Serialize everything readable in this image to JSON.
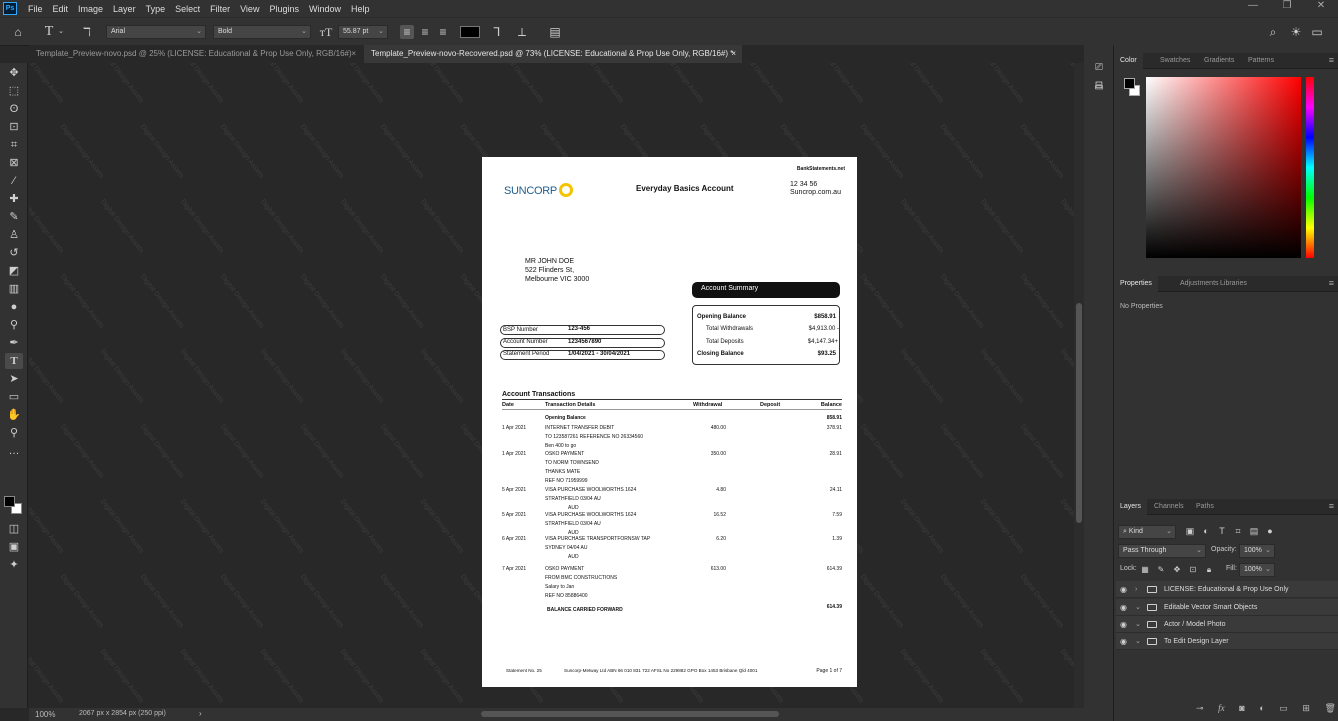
{
  "app": {
    "logo": "Ps"
  },
  "menu": [
    "File",
    "Edit",
    "Image",
    "Layer",
    "Type",
    "Select",
    "Filter",
    "View",
    "Plugins",
    "Window",
    "Help"
  ],
  "options": {
    "font_family": "Arial",
    "font_style": "Bold",
    "font_size": "55.87 pt",
    "text_color": "#000000"
  },
  "tabs": [
    {
      "label": "Template_Preview-novo.psd @ 25% (LICENSE: Educational & Prop Use Only, RGB/16#)",
      "close": "×"
    },
    {
      "label": "Template_Preview-novo-Recovered.psd @ 73% (LICENSE: Educational & Prop Use Only, RGB/16#) *",
      "close": "×"
    }
  ],
  "watermark_text": "Digital Design Assets",
  "statement": {
    "site": "BankStatements.net",
    "brand": "SUNCORP",
    "account_title": "Everyday Basics Account",
    "phone": "12 34 56",
    "web": "Suncrop.com.au",
    "addr1": "MR JOHN DOE",
    "addr2": "522 Flinders St,",
    "addr3": "Melbourne VIC 3000",
    "summary_title": "Account Summary",
    "bsb_label": "BSP Number",
    "bsb": "123-456",
    "acct_label": "Account Number",
    "acct": "1234567890",
    "period_label": "Statement Period",
    "period": "1/04/2021 - 30/04/2021",
    "opening_label": "Opening Balance",
    "opening": "$858.91",
    "withdrawals_label": "Total Withdrawals",
    "withdrawals": "$4,913.00 -",
    "deposits_label": "Total Deposits",
    "deposits": "$4,147.34+",
    "closing_label": "Closing Balance",
    "closing": "$93.25",
    "tx_title": "Account Transactions",
    "tx_cols": {
      "date": "Date",
      "details": "Transaction Details",
      "withdrawal": "Withdrawal",
      "deposit": "Deposit",
      "balance": "Balance"
    },
    "tx_opening_label": "Opening Balance",
    "tx_opening": "858.91",
    "tx": [
      {
        "date": "1 Apr 2021",
        "lines": [
          "INTERNET TRANSFER DEBIT",
          "TO 123587261 REFERENCE NO 26334560",
          "Ben 400 to go"
        ],
        "withdrawal": "480.00",
        "balance": "378.91"
      },
      {
        "date": "1 Apr 2021",
        "lines": [
          "OSKO PAYMENT",
          "TO NORM TOWNSEND",
          "THANKS MATE",
          "REF NO 71959999"
        ],
        "withdrawal": "350.00",
        "balance": "28.91"
      },
      {
        "date": "5 Apr 2021",
        "lines": [
          "VISA PURCHASE WOOLWORTHS 1624",
          "STRATHFIELD  03/04 AU",
          "AUD"
        ],
        "withdrawal": "4.80",
        "balance": "24.11"
      },
      {
        "date": "5 Apr 2021",
        "lines": [
          "VISA PURCHASE WOOLWORTHS 1624",
          "STRATHFIELD 03/04 AU",
          "AUD"
        ],
        "withdrawal": "16.52",
        "balance": "7.59"
      },
      {
        "date": "6 Apr 2021",
        "lines": [
          "VISA PURCHASE TRANSPORTFORNSW TAP",
          "SYDNEY 04/04 AU",
          "AUD"
        ],
        "withdrawal": "6.20",
        "balance": "1.39"
      },
      {
        "date": "7 Apr 2021",
        "lines": [
          "OSKO PAYMENT",
          "FROM BMC CONSTRUCTIONS",
          "Salary to Jan",
          "REF NO 85886400"
        ],
        "withdrawal": "613.00",
        "balance": "614.39"
      }
    ],
    "carried_label": "BALANCE CARRIED FORWARD",
    "carried": "614.39",
    "footer_no": "Statement No. 25",
    "footer_text": "Suncorp-Metway Ltd ABN 66 010 831 722 AFSL No 229882 GPO Box 1453 Brisbane Qld 4001",
    "footer_page": "Page 1 of 7"
  },
  "panels": {
    "color_tabs": [
      "Color",
      "Swatches",
      "Gradients",
      "Patterns"
    ],
    "props_tabs": [
      "Properties",
      "Adjustments",
      "Libraries"
    ],
    "no_props": "No Properties",
    "layer_tabs": [
      "Layers",
      "Channels",
      "Paths"
    ],
    "kind": "Kind",
    "blend": "Pass Through",
    "opacity_label": "Opacity:",
    "opacity": "100%",
    "lock_label": "Lock:",
    "fill_label": "Fill:",
    "fill": "100%",
    "layers": [
      "LICENSE: Educational & Prop Use Only",
      "Editable Vector Smart Objects",
      "Actor / Model Photo",
      "To Edit Design Layer"
    ]
  },
  "status": {
    "zoom": "100%",
    "info": "2067 px x 2854 px (250 ppi)"
  },
  "colors": {
    "foreground": "#000000",
    "background": "#ffffff",
    "accent_brand": "#1f5d8c",
    "sun": "#f5c400"
  }
}
